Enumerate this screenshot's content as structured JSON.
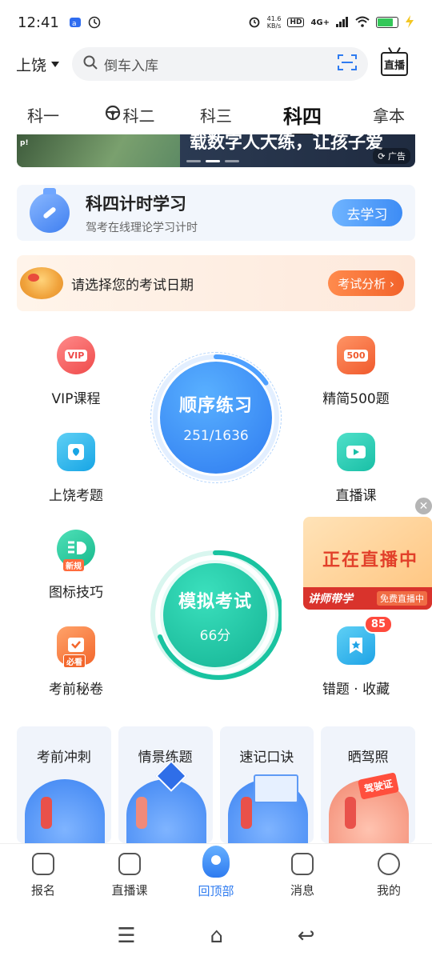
{
  "status": {
    "time": "12:41",
    "netspeed_value": "41.6",
    "netspeed_unit": "KB/s",
    "hd": "HD",
    "network": "4G+"
  },
  "header": {
    "city": "上饶",
    "search_placeholder": "倒车入库",
    "live_label": "直播"
  },
  "tabs": [
    {
      "label": "科一",
      "active": false
    },
    {
      "label": "科二",
      "active": false
    },
    {
      "label": "科三",
      "active": false
    },
    {
      "label": "科四",
      "active": true
    },
    {
      "label": "拿本",
      "active": false
    }
  ],
  "banner": {
    "text": "载数字人大练，让孩子爱",
    "game_text": "p!",
    "ad_label": "广告"
  },
  "timer_card": {
    "title": "科四计时学习",
    "subtitle": "驾考在线理论学习计时",
    "button": "去学习"
  },
  "exam_card": {
    "text": "请选择您的考试日期",
    "button": "考试分析 ›"
  },
  "features_left": [
    {
      "label": "VIP课程",
      "icon": "vip-icon",
      "chip": "VIP"
    },
    {
      "label": "上饶考题",
      "icon": "location-book-icon"
    },
    {
      "label": "图标技巧",
      "icon": "sign-tips-icon",
      "badge": "新规"
    },
    {
      "label": "考前秘卷",
      "icon": "exam-paper-icon",
      "badge": "必看"
    }
  ],
  "features_right": [
    {
      "label": "精简500题",
      "icon": "500-questions-icon",
      "chip": "500"
    },
    {
      "label": "直播课",
      "icon": "video-icon"
    },
    {
      "label": "错题 · 收藏",
      "icon": "star-bookmark-icon",
      "badge": "85"
    }
  ],
  "practice": {
    "order_title": "顺序练习",
    "order_progress": "251/1636",
    "order_done": 251,
    "order_total": 1636,
    "mock_title": "模拟考试",
    "mock_score": "66分"
  },
  "live_float": {
    "title": "正在直播中",
    "left": "讲师带学",
    "right": "免费直播中"
  },
  "cards": [
    {
      "label": "考前冲刺"
    },
    {
      "label": "情景练题"
    },
    {
      "label": "速记口诀"
    },
    {
      "label": "晒驾照",
      "tag": "驾驶证"
    }
  ],
  "bottom_nav": [
    {
      "label": "报名",
      "icon": "register-icon"
    },
    {
      "label": "直播课",
      "icon": "tv-icon"
    },
    {
      "label": "回顶部",
      "icon": "rocket-icon",
      "active": true
    },
    {
      "label": "消息",
      "icon": "message-icon"
    },
    {
      "label": "我的",
      "icon": "profile-icon"
    }
  ],
  "colors": {
    "accent": "#2e7bf0",
    "order_circle": "#3d8cf5",
    "mock_circle": "#19c3a0",
    "live_red": "#e2402a"
  }
}
